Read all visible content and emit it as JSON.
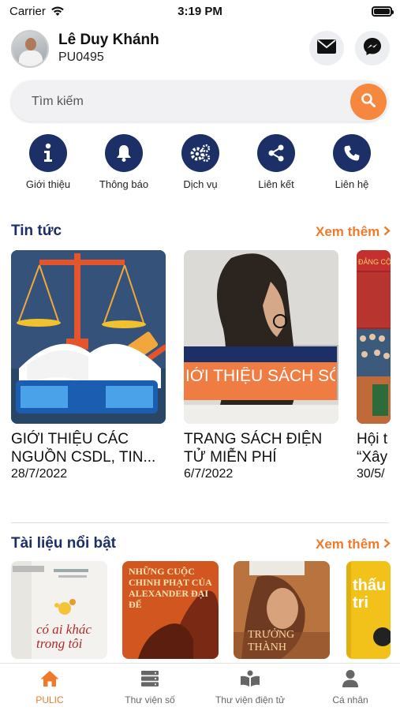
{
  "status_bar": {
    "carrier": "Carrier",
    "time": "3:19 PM"
  },
  "profile": {
    "name": "Lê Duy Khánh",
    "code": "PU0495"
  },
  "search": {
    "placeholder": "Tìm kiếm"
  },
  "quick_actions": [
    {
      "label": "Giới thiệu",
      "icon": "info-icon"
    },
    {
      "label": "Thông báo",
      "icon": "bell-icon"
    },
    {
      "label": "Dịch vụ",
      "icon": "gears-icon"
    },
    {
      "label": "Liên kết",
      "icon": "share-icon"
    },
    {
      "label": "Liên hệ",
      "icon": "phone-icon"
    }
  ],
  "news": {
    "title": "Tin tức",
    "more": "Xem thêm",
    "items": [
      {
        "title": "GIỚI THIỆU CÁC\nNGUỒN CSDL, TIN...",
        "date": "28/7/2022"
      },
      {
        "title": "TRANG SÁCH ĐIỆN\nTỬ MIỄN PHÍ",
        "date": "6/7/2022",
        "banner": "IỚI THIỆU SÁCH SỐ"
      },
      {
        "title": "Hội t\n“Xây",
        "date": "30/5/"
      }
    ]
  },
  "featured": {
    "title": "Tài liệu nổi bật",
    "more": "Xem thêm",
    "books": [
      {
        "cover": "có ai khác trong tôi"
      },
      {
        "cover": "NHỮNG CUỘC CHINH PHẠT CỦA ALEXANDER ĐẠI ĐẾ"
      },
      {
        "cover": "TRƯỞNG THÀNH"
      },
      {
        "cover": "thấu tri"
      }
    ]
  },
  "tabbar": {
    "tabs": [
      {
        "label": "PULIC",
        "icon": "home-icon",
        "active": true
      },
      {
        "label": "Thư viện số",
        "icon": "server-icon",
        "active": false
      },
      {
        "label": "Thư viện điện tử",
        "icon": "book-icon",
        "active": false
      },
      {
        "label": "Cá nhân",
        "icon": "user-icon",
        "active": false
      }
    ]
  },
  "colors": {
    "accent": "#f07a2c",
    "primary": "#1c2f66",
    "search_button": "#f6873f"
  }
}
